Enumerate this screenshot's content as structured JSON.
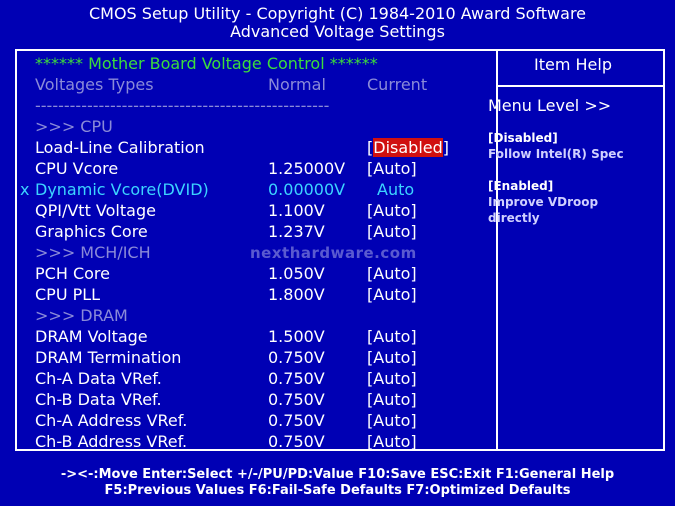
{
  "header": {
    "line1": "CMOS Setup Utility - Copyright (C) 1984-2010 Award Software",
    "line2": "Advanced Voltage Settings"
  },
  "main": {
    "section_title": "****** Mother Board Voltage Control ******",
    "col_type": "Voltages Types",
    "col_normal": "Normal",
    "col_current": "Current",
    "separator": "---------------------------------------------------",
    "groups": {
      "cpu": ">>> CPU",
      "mch": ">>> MCH/ICH",
      "dram": ">>> DRAM"
    },
    "rows": [
      {
        "name": "Load-Line Calibration",
        "normal": "",
        "current": "Disabled",
        "selected": true
      },
      {
        "name": "CPU Vcore",
        "normal": "1.25000V",
        "current": "[Auto]"
      },
      {
        "name": "Dynamic Vcore(DVID)",
        "normal": "0.00000V",
        "current": "Auto",
        "marker": "x"
      },
      {
        "name": "QPI/Vtt Voltage",
        "normal": "1.100V",
        "current": "[Auto]"
      },
      {
        "name": "Graphics Core",
        "normal": "1.237V",
        "current": "[Auto]"
      },
      {
        "name": "PCH Core",
        "normal": "1.050V",
        "current": "[Auto]"
      },
      {
        "name": "CPU PLL",
        "normal": "1.800V",
        "current": "[Auto]"
      },
      {
        "name": "DRAM Voltage",
        "normal": "1.500V",
        "current": "[Auto]"
      },
      {
        "name": "DRAM Termination",
        "normal": "0.750V",
        "current": "[Auto]"
      },
      {
        "name": "Ch-A Data VRef.",
        "normal": "0.750V",
        "current": "[Auto]"
      },
      {
        "name": "Ch-B Data VRef.",
        "normal": "0.750V",
        "current": "[Auto]"
      },
      {
        "name": "Ch-A Address VRef.",
        "normal": "0.750V",
        "current": "[Auto]"
      },
      {
        "name": "Ch-B Address VRef.",
        "normal": "0.750V",
        "current": "[Auto]"
      }
    ]
  },
  "help": {
    "title": "Item Help",
    "menu_level": "Menu Level  >>",
    "disabled_tag": "[Disabled]",
    "disabled_desc": "Follow Intel(R) Spec",
    "enabled_tag": "[Enabled]",
    "enabled_desc1": "Improve VDroop",
    "enabled_desc2": "directly"
  },
  "watermark": "nexthardware.com",
  "footer": {
    "line1": "-><-:Move  Enter:Select  +/-/PU/PD:Value  F10:Save  ESC:Exit  F1:General Help",
    "line2": "F5:Previous Values  F6:Fail-Safe Defaults  F7:Optimized Defaults"
  },
  "colors": {
    "background": "#0000b4",
    "highlight": "#d01010",
    "section_green": "#3cdc3c",
    "disabled_gray": "#8a8ad8",
    "dvid_cyan": "#3cd4ff"
  }
}
